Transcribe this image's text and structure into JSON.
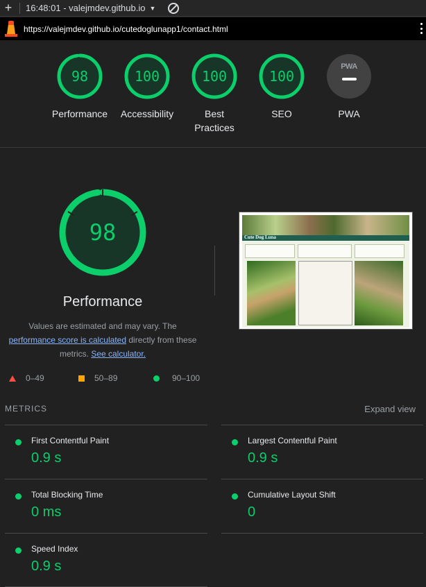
{
  "topbar": {
    "report_label": "16:48:01 - valejmdev.github.io"
  },
  "urlbar": {
    "url": "https://valejmdev.github.io/cutedoglunapp1/contact.html"
  },
  "gauges": [
    {
      "label": "Performance",
      "score": "98",
      "color": "#0cce6b"
    },
    {
      "label": "Accessibility",
      "score": "100",
      "color": "#0cce6b"
    },
    {
      "label": "Best Practices",
      "score": "100",
      "color": "#0cce6b"
    },
    {
      "label": "SEO",
      "score": "100",
      "color": "#0cce6b"
    },
    {
      "label": "PWA",
      "badge": "PWA"
    }
  ],
  "performance": {
    "score": "98",
    "title": "Performance",
    "desc_prefix": "Values are estimated and may vary. The",
    "desc_link": "performance score is calculated",
    "desc_mid": "directly from these metrics.",
    "calc_link": "See calculator."
  },
  "screenshot": {
    "site_title": "Cute Dog Luna"
  },
  "legend": {
    "fail": "0–49",
    "average": "50–89",
    "pass": "90–100"
  },
  "metrics": {
    "header": "METRICS",
    "expand": "Expand view",
    "items": [
      {
        "title": "First Contentful Paint",
        "value": "0.9 s"
      },
      {
        "title": "Largest Contentful Paint",
        "value": "0.9 s"
      },
      {
        "title": "Total Blocking Time",
        "value": "0 ms"
      },
      {
        "title": "Cumulative Layout Shift",
        "value": "0"
      },
      {
        "title": "Speed Index",
        "value": "0.9 s"
      }
    ]
  },
  "colors": {
    "pass": "#0cce6b",
    "average": "#ffa400",
    "fail": "#ff4e42",
    "link": "#8ab4f8"
  }
}
